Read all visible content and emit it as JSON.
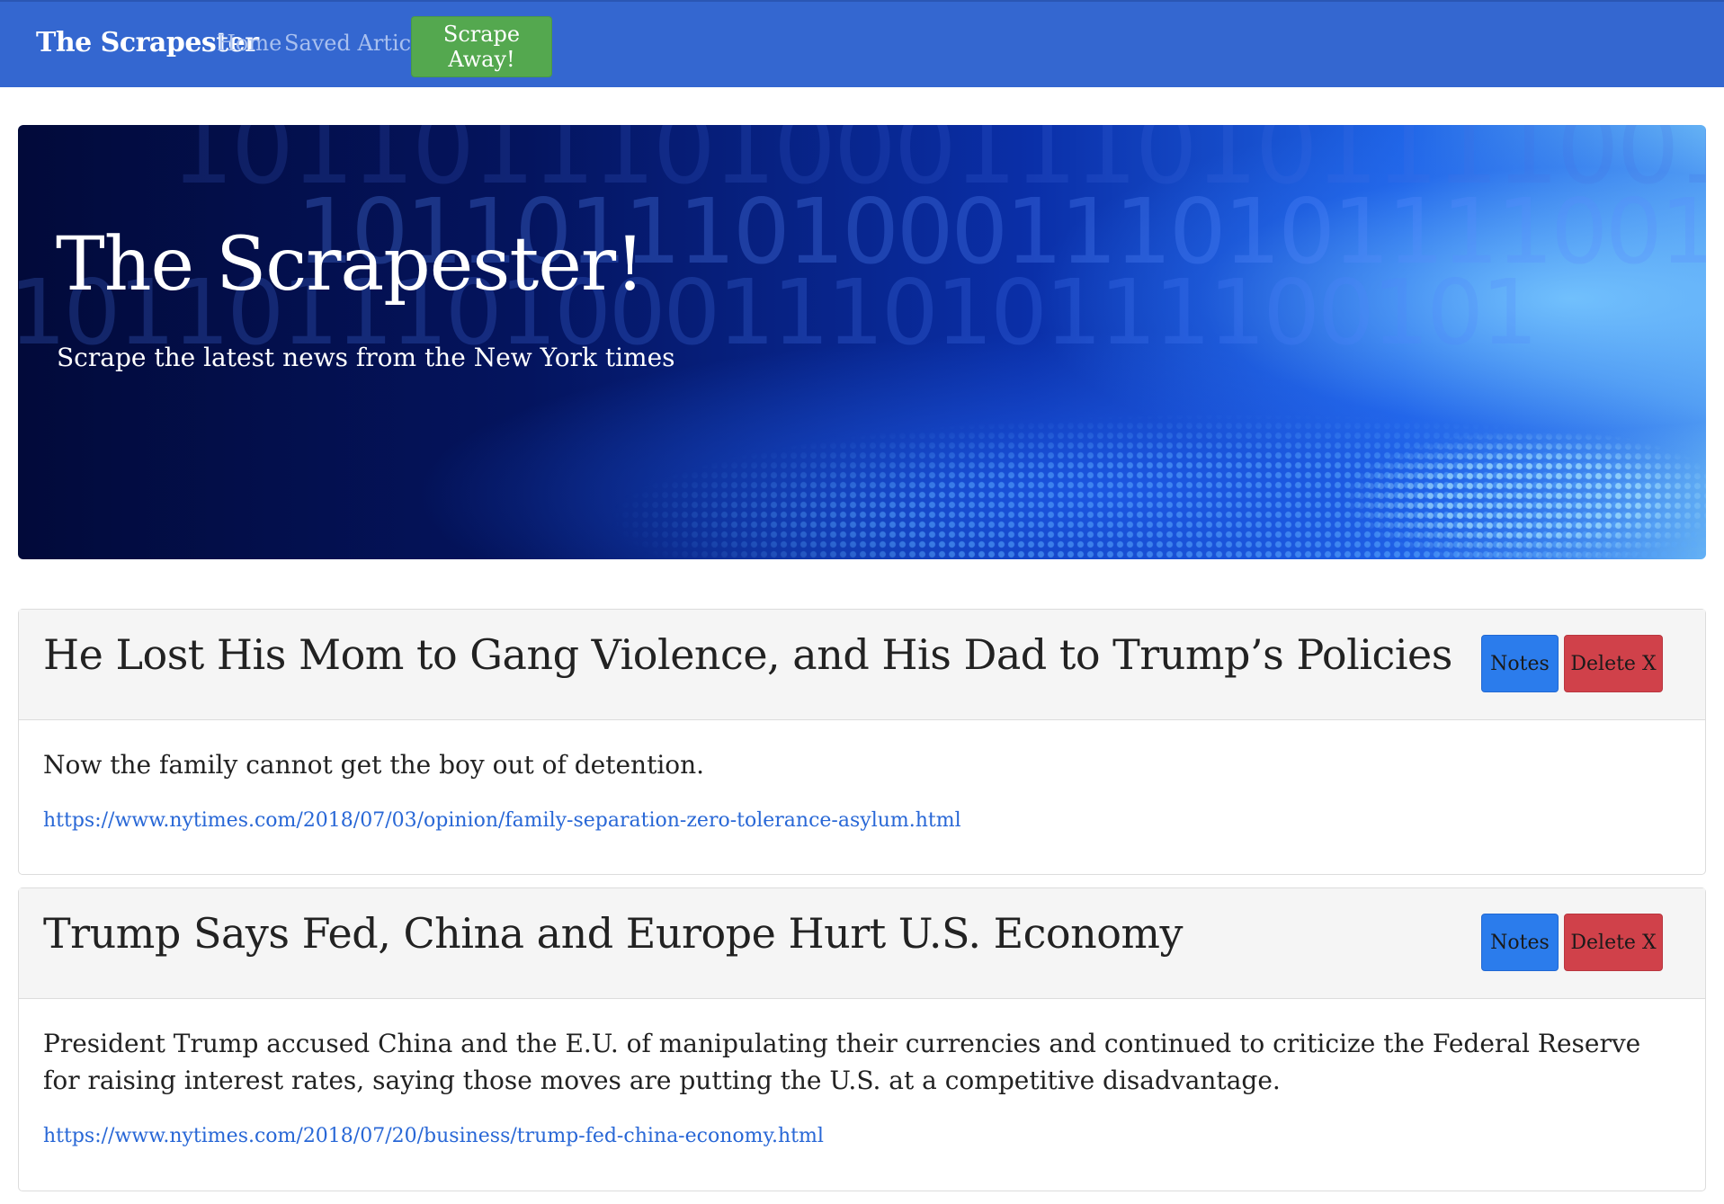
{
  "navbar": {
    "brand": "The Scrapester",
    "links": [
      {
        "label": "Home"
      },
      {
        "label": "Saved Articles"
      }
    ],
    "scrape_button": "Scrape Away!",
    "color": "#3467d0",
    "scrape_button_color": "#54a84f"
  },
  "hero": {
    "title": "The Scrapester!",
    "subtitle": "Scrape the latest news from the New York times"
  },
  "articles": [
    {
      "title": "He Lost His Mom to Gang Violence, and His Dad to Trump’s Policies",
      "summary": "Now the family cannot get the boy out of detention.",
      "url": "https://www.nytimes.com/2018/07/03/opinion/family-separation-zero-tolerance-asylum.html",
      "notes_label": "Notes",
      "delete_label": "Delete X"
    },
    {
      "title": "Trump Says Fed, China and Europe Hurt U.S. Economy",
      "summary": "President Trump accused China and the E.U. of manipulating their currencies and continued to criticize the Federal Reserve for raising interest rates, saying those moves are putting the U.S. at a competitive disadvantage.",
      "url": "https://www.nytimes.com/2018/07/20/business/trump-fed-china-economy.html",
      "notes_label": "Notes",
      "delete_label": "Delete X"
    }
  ],
  "colors": {
    "notes_button": "#2b7cec",
    "delete_button": "#d0414a",
    "link": "#2867d6"
  }
}
